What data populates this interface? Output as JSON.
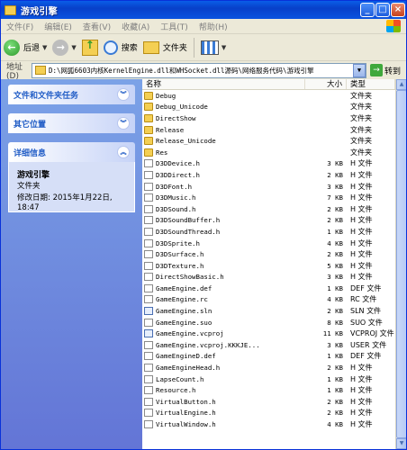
{
  "window": {
    "title": "游戏引擎"
  },
  "menu": [
    "文件(F)",
    "编辑(E)",
    "查看(V)",
    "收藏(A)",
    "工具(T)",
    "帮助(H)"
  ],
  "toolbar": {
    "back": "后退",
    "search": "搜索",
    "folders": "文件夹"
  },
  "address": {
    "label": "地址(D)",
    "path": "D:\\网狐6603内核KernelEngine.dll和WHSocket.dll源码\\网络服务代码\\游戏引擎",
    "go": "转到"
  },
  "tasks": [
    {
      "title": "文件和文件夹任务"
    },
    {
      "title": "其它位置"
    },
    {
      "title": "详细信息"
    }
  ],
  "details": {
    "name": "游戏引擎",
    "type": "文件夹",
    "modified": "修改日期: 2015年1月22日, 18:47"
  },
  "columns": {
    "name": "名称",
    "size": "大小",
    "type": "类型"
  },
  "files": [
    {
      "name": "Debug",
      "size": "",
      "type": "文件夹",
      "icon": "folder"
    },
    {
      "name": "Debug_Unicode",
      "size": "",
      "type": "文件夹",
      "icon": "folder"
    },
    {
      "name": "DirectShow",
      "size": "",
      "type": "文件夹",
      "icon": "folder"
    },
    {
      "name": "Release",
      "size": "",
      "type": "文件夹",
      "icon": "folder"
    },
    {
      "name": "Release_Unicode",
      "size": "",
      "type": "文件夹",
      "icon": "folder"
    },
    {
      "name": "Res",
      "size": "",
      "type": "文件夹",
      "icon": "folder"
    },
    {
      "name": "D3DDevice.h",
      "size": "3 KB",
      "type": "H 文件",
      "icon": "file"
    },
    {
      "name": "D3DDirect.h",
      "size": "2 KB",
      "type": "H 文件",
      "icon": "file"
    },
    {
      "name": "D3DFont.h",
      "size": "3 KB",
      "type": "H 文件",
      "icon": "file"
    },
    {
      "name": "D3DMusic.h",
      "size": "7 KB",
      "type": "H 文件",
      "icon": "file"
    },
    {
      "name": "D3DSound.h",
      "size": "2 KB",
      "type": "H 文件",
      "icon": "file"
    },
    {
      "name": "D3DSoundBuffer.h",
      "size": "2 KB",
      "type": "H 文件",
      "icon": "file"
    },
    {
      "name": "D3DSoundThread.h",
      "size": "1 KB",
      "type": "H 文件",
      "icon": "file"
    },
    {
      "name": "D3DSprite.h",
      "size": "4 KB",
      "type": "H 文件",
      "icon": "file"
    },
    {
      "name": "D3DSurface.h",
      "size": "2 KB",
      "type": "H 文件",
      "icon": "file"
    },
    {
      "name": "D3DTexture.h",
      "size": "5 KB",
      "type": "H 文件",
      "icon": "file"
    },
    {
      "name": "DirectShowBasic.h",
      "size": "3 KB",
      "type": "H 文件",
      "icon": "file"
    },
    {
      "name": "GameEngine.def",
      "size": "1 KB",
      "type": "DEF 文件",
      "icon": "file"
    },
    {
      "name": "GameEngine.rc",
      "size": "4 KB",
      "type": "RC 文件",
      "icon": "file"
    },
    {
      "name": "GameEngine.sln",
      "size": "2 KB",
      "type": "SLN 文件",
      "icon": "doc"
    },
    {
      "name": "GameEngine.suo",
      "size": "8 KB",
      "type": "SUO 文件",
      "icon": "file"
    },
    {
      "name": "GameEngine.vcproj",
      "size": "11 KB",
      "type": "VCPROJ 文件",
      "icon": "doc"
    },
    {
      "name": "GameEngine.vcproj.KKKJE...",
      "size": "3 KB",
      "type": "USER 文件",
      "icon": "file"
    },
    {
      "name": "GameEngineD.def",
      "size": "1 KB",
      "type": "DEF 文件",
      "icon": "file"
    },
    {
      "name": "GameEngineHead.h",
      "size": "2 KB",
      "type": "H 文件",
      "icon": "file"
    },
    {
      "name": "LapseCount.h",
      "size": "1 KB",
      "type": "H 文件",
      "icon": "file"
    },
    {
      "name": "Resource.h",
      "size": "1 KB",
      "type": "H 文件",
      "icon": "file"
    },
    {
      "name": "VirtualButton.h",
      "size": "2 KB",
      "type": "H 文件",
      "icon": "file"
    },
    {
      "name": "VirtualEngine.h",
      "size": "2 KB",
      "type": "H 文件",
      "icon": "file"
    },
    {
      "name": "VirtualWindow.h",
      "size": "4 KB",
      "type": "H 文件",
      "icon": "file"
    }
  ]
}
